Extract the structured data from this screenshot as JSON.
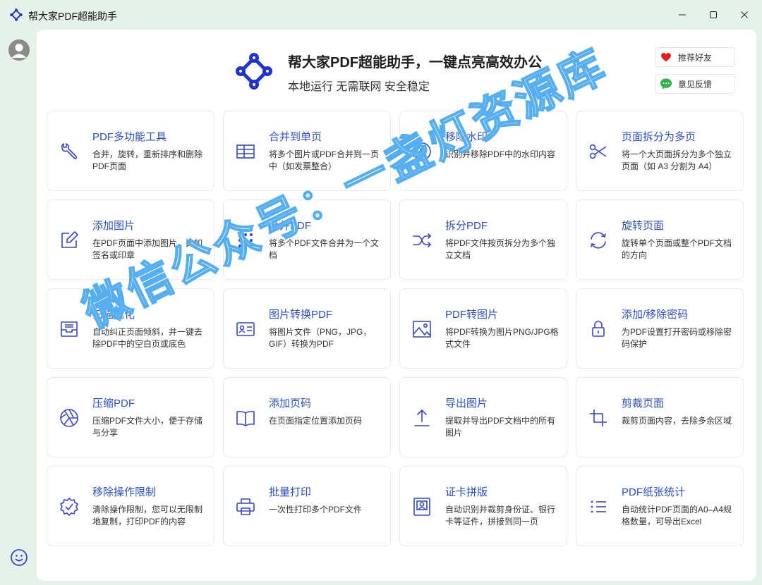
{
  "window": {
    "title": "帮大家PDF超能助手",
    "minimize_icon": "minimize-icon",
    "maximize_icon": "maximize-icon",
    "close_icon": "close-icon"
  },
  "sidebar": {
    "avatar_icon": "user-avatar-icon",
    "feedback_icon": "smiley-icon"
  },
  "header": {
    "title": "帮大家PDF超能助手，一键点亮高效办公",
    "subtitle": "本地运行 无需联网 安全稳定",
    "recommend_label": "推荐好友",
    "feedback_label": "意见反馈"
  },
  "tools": [
    {
      "title": "PDF多功能工具",
      "desc": "合并，旋转，重新排序和删除PDF页面",
      "icon": "wrench-icon"
    },
    {
      "title": "合并到单页",
      "desc": "将多个图片或PDF合并到一页中（如发票整合）",
      "icon": "table-icon"
    },
    {
      "title": "移除水印",
      "desc": "识别并移除PDF中的水印内容",
      "icon": "watermark-icon"
    },
    {
      "title": "页面拆分为多页",
      "desc": "将一个大页面拆分为多个独立页面（如 A3 分割为 A4）",
      "icon": "scissors-icon"
    },
    {
      "title": "添加图片",
      "desc": "在PDF页面中添加图片，比如签名或印章",
      "icon": "edit-icon"
    },
    {
      "title": "合并PDF",
      "desc": "将多个PDF文件合并为一个文档",
      "icon": "grid-dots-icon"
    },
    {
      "title": "拆分PDF",
      "desc": "将PDF文件按页拆分为多个独立文档",
      "icon": "shuffle-icon"
    },
    {
      "title": "旋转页面",
      "desc": "旋转单个页面或整个PDF文档的方向",
      "icon": "rotate-icon"
    },
    {
      "title": "扫描优化",
      "desc": "自动纠正页面倾斜，并一键去除PDF中的空白页或底色",
      "icon": "inbox-icon"
    },
    {
      "title": "图片转换PDF",
      "desc": "将图片文件（PNG，JPG，GIF）转换为PDF",
      "icon": "id-card-icon"
    },
    {
      "title": "PDF转图片",
      "desc": "将PDF转换为图片PNG/JPG格式文件",
      "icon": "image-icon"
    },
    {
      "title": "添加/移除密码",
      "desc": "为PDF设置打开密码或移除密码保护",
      "icon": "lock-icon"
    },
    {
      "title": "压缩PDF",
      "desc": "压缩PDF文件大小，便于存储与分享",
      "icon": "aperture-icon"
    },
    {
      "title": "添加页码",
      "desc": "在页面指定位置添加页码",
      "icon": "book-icon"
    },
    {
      "title": "导出图片",
      "desc": "提取并导出PDF文档中的所有图片",
      "icon": "upload-icon"
    },
    {
      "title": "剪裁页面",
      "desc": "裁剪页面内容，去除多余区域",
      "icon": "crop-icon"
    },
    {
      "title": "移除操作限制",
      "desc": "清除操作限制，您可以无限制地复制，打印PDF的内容",
      "icon": "badge-check-icon"
    },
    {
      "title": "批量打印",
      "desc": "一次性打印多个PDF文件",
      "icon": "printer-icon"
    },
    {
      "title": "证卡拼版",
      "desc": "自动识别并裁剪身份证、银行卡等证件，拼接到同一页",
      "icon": "portrait-icon"
    },
    {
      "title": "PDF纸张统计",
      "desc": "自动统计PDF页面的A0–A4规格数量，可导出Excel",
      "icon": "list-icon"
    }
  ],
  "watermark": {
    "text": "微信公众号：一盏灯资源库"
  },
  "colors": {
    "accent": "#2b4fc4",
    "icon": "#3447c9",
    "background": "#e6f1ea"
  }
}
